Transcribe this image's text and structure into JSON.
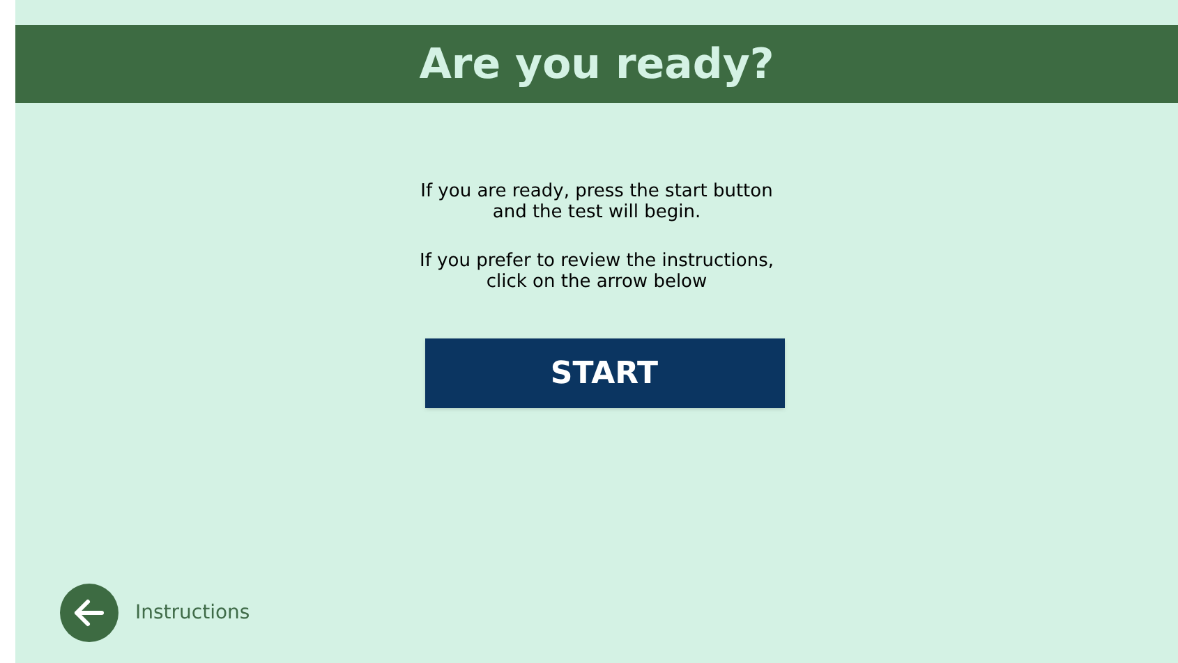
{
  "header": {
    "title": "Are you ready?"
  },
  "paragraphs": [
    [
      "If you are ready, press the start button",
      "and the test will begin."
    ],
    [
      "If you prefer to review the instructions,",
      "click on the arrow below"
    ]
  ],
  "start_button": {
    "label": "START"
  },
  "back_link": {
    "label": "Instructions"
  }
}
